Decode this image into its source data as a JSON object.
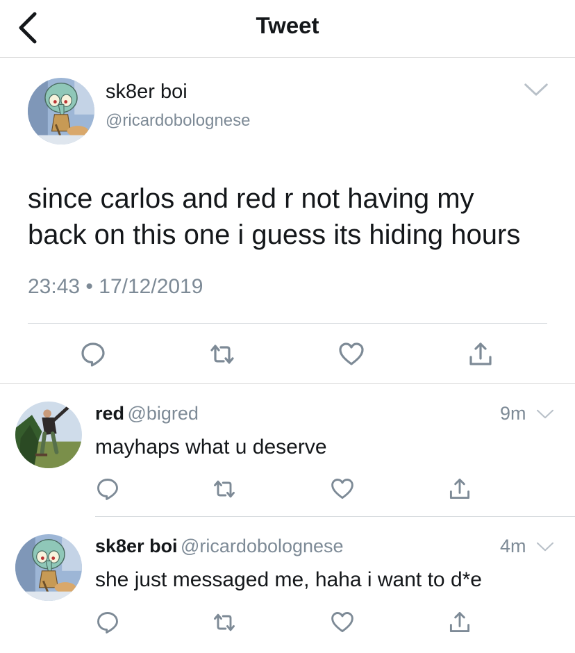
{
  "header": {
    "title": "Tweet"
  },
  "main_tweet": {
    "display_name": "sk8er boi",
    "handle": "@ricardobolognese",
    "text_line1": "since carlos and red r not having my",
    "text_line2": "back on this one i guess its hiding hours",
    "time": "23:43",
    "separator": "•",
    "date": "17/12/2019"
  },
  "replies": [
    {
      "display_name": "red",
      "handle": "@bigred",
      "time_ago": "9m",
      "text": "mayhaps what u deserve"
    },
    {
      "display_name": "sk8er boi",
      "handle": "@ricardobolognese",
      "time_ago": "4m",
      "text": "she just messaged me, haha i want to d*e"
    }
  ],
  "icons": {
    "back": "chevron-left-icon",
    "more": "chevron-down-icon",
    "reply": "reply-icon",
    "retweet": "retweet-icon",
    "like": "heart-icon",
    "share": "share-icon"
  },
  "colors": {
    "text": "#14171a",
    "secondary": "#7d8a96",
    "divider": "#d9dde0"
  }
}
